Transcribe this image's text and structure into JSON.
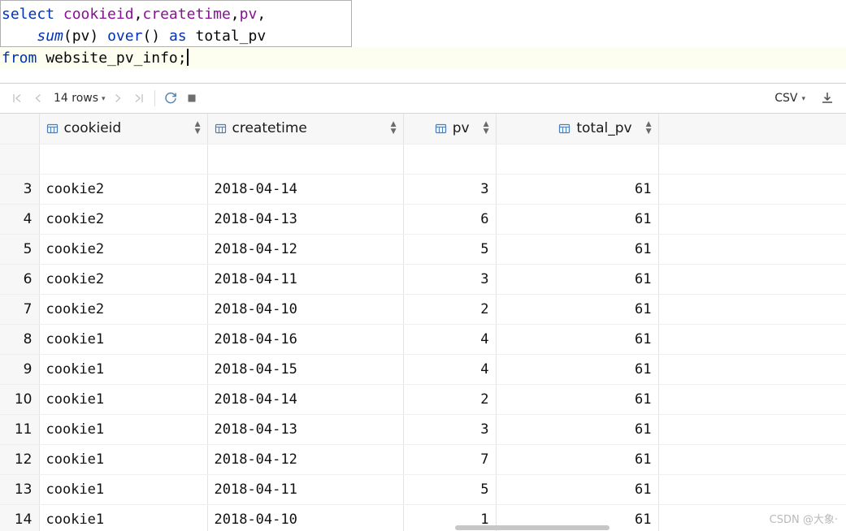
{
  "editor": {
    "lines": [
      {
        "tokens": [
          {
            "t": "select",
            "c": "kw"
          },
          {
            "t": " ",
            "c": "plain"
          },
          {
            "t": "cookieid",
            "c": "ident"
          },
          {
            "t": ",",
            "c": "punct"
          },
          {
            "t": "createtime",
            "c": "ident"
          },
          {
            "t": ",",
            "c": "punct"
          },
          {
            "t": "pv",
            "c": "ident"
          },
          {
            "t": ",",
            "c": "punct"
          }
        ]
      },
      {
        "tokens": [
          {
            "t": "    ",
            "c": "plain"
          },
          {
            "t": "sum",
            "c": "func"
          },
          {
            "t": "(",
            "c": "punct"
          },
          {
            "t": "pv",
            "c": "plain"
          },
          {
            "t": ") ",
            "c": "punct"
          },
          {
            "t": "over",
            "c": "kw"
          },
          {
            "t": "() ",
            "c": "punct"
          },
          {
            "t": "as",
            "c": "kw"
          },
          {
            "t": " total_pv",
            "c": "plain"
          }
        ]
      },
      {
        "tokens": [
          {
            "t": "from",
            "c": "kw"
          },
          {
            "t": " website_pv_info",
            "c": "plain"
          },
          {
            "t": ";",
            "c": "punct"
          }
        ]
      }
    ],
    "full_text": "select cookieid,createtime,pv,\n    sum(pv) over() as total_pv\nfrom website_pv_info;"
  },
  "toolbar": {
    "first_page_icon": "first-page-icon",
    "prev_page_icon": "previous-page-icon",
    "rows_label": "14 rows",
    "rows_dropdown_icon": "chevron-down-icon",
    "next_page_icon": "next-page-icon",
    "last_page_icon": "last-page-icon",
    "refresh_icon": "refresh-icon",
    "stop_icon": "stop-icon",
    "export_format": "CSV",
    "export_dropdown_icon": "chevron-down-icon",
    "download_icon": "download-icon"
  },
  "grid": {
    "columns": [
      {
        "label": "cookieid",
        "align": "left",
        "icon": "table-column-icon",
        "sort_icon": "sort-toggle-icon"
      },
      {
        "label": "createtime",
        "align": "left",
        "icon": "table-column-icon",
        "sort_icon": "sort-toggle-icon"
      },
      {
        "label": "pv",
        "align": "right",
        "icon": "table-column-icon",
        "sort_icon": "sort-toggle-icon"
      },
      {
        "label": "total_pv",
        "align": "right",
        "icon": "table-column-icon",
        "sort_icon": "sort-toggle-icon"
      }
    ],
    "rows": [
      {
        "n": "3",
        "cookieid": "cookie2",
        "createtime": "2018-04-14",
        "pv": "3",
        "total_pv": "61"
      },
      {
        "n": "4",
        "cookieid": "cookie2",
        "createtime": "2018-04-13",
        "pv": "6",
        "total_pv": "61"
      },
      {
        "n": "5",
        "cookieid": "cookie2",
        "createtime": "2018-04-12",
        "pv": "5",
        "total_pv": "61"
      },
      {
        "n": "6",
        "cookieid": "cookie2",
        "createtime": "2018-04-11",
        "pv": "3",
        "total_pv": "61"
      },
      {
        "n": "7",
        "cookieid": "cookie2",
        "createtime": "2018-04-10",
        "pv": "2",
        "total_pv": "61"
      },
      {
        "n": "8",
        "cookieid": "cookie1",
        "createtime": "2018-04-16",
        "pv": "4",
        "total_pv": "61"
      },
      {
        "n": "9",
        "cookieid": "cookie1",
        "createtime": "2018-04-15",
        "pv": "4",
        "total_pv": "61"
      },
      {
        "n": "10",
        "cookieid": "cookie1",
        "createtime": "2018-04-14",
        "pv": "2",
        "total_pv": "61"
      },
      {
        "n": "11",
        "cookieid": "cookie1",
        "createtime": "2018-04-13",
        "pv": "3",
        "total_pv": "61"
      },
      {
        "n": "12",
        "cookieid": "cookie1",
        "createtime": "2018-04-12",
        "pv": "7",
        "total_pv": "61"
      },
      {
        "n": "13",
        "cookieid": "cookie1",
        "createtime": "2018-04-11",
        "pv": "5",
        "total_pv": "61"
      },
      {
        "n": "14",
        "cookieid": "cookie1",
        "createtime": "2018-04-10",
        "pv": "1",
        "total_pv": "61"
      }
    ]
  },
  "watermark": "CSDN @大象·"
}
